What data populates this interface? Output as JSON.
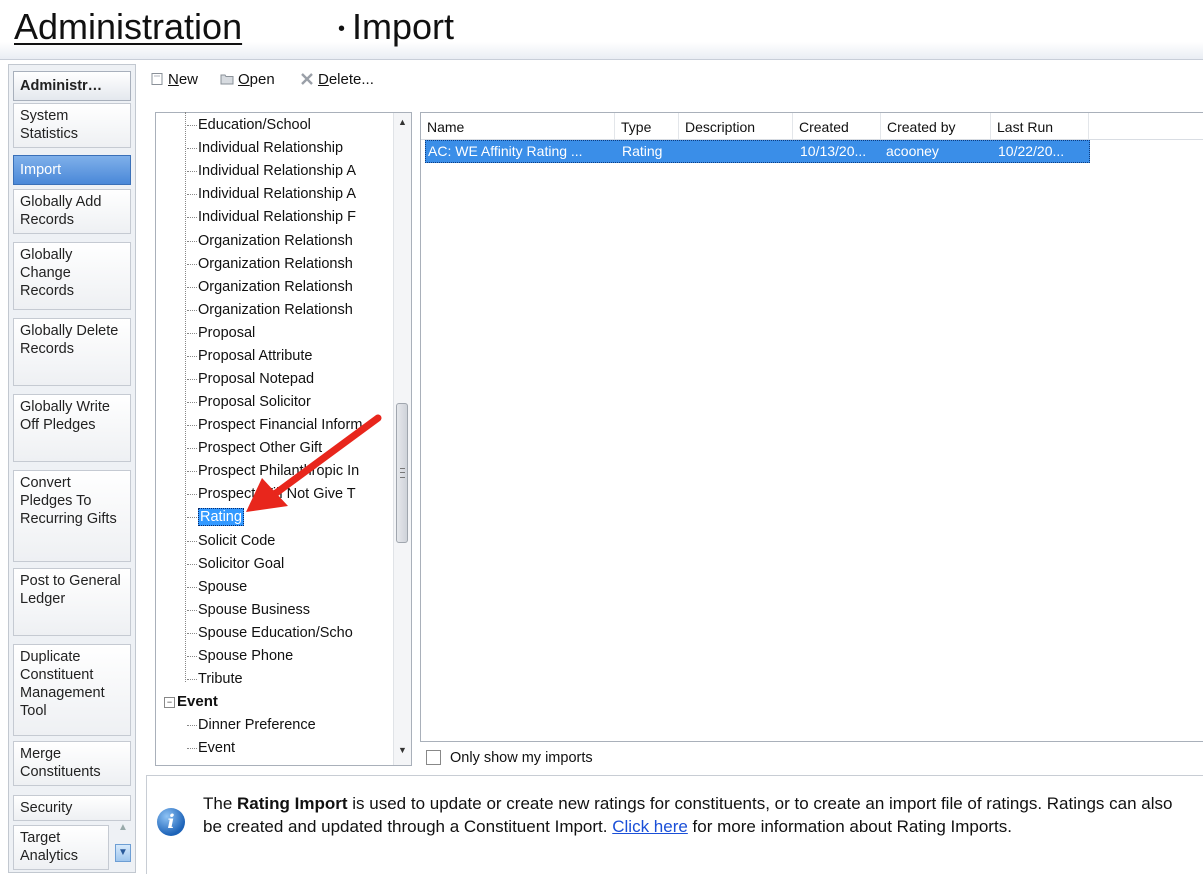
{
  "window": {
    "title_main": "Administration",
    "title_separator": "•",
    "title_sub": "Import"
  },
  "nav": {
    "items": [
      {
        "label": "Administr…",
        "state": "header"
      },
      {
        "label": "System Statistics"
      },
      {
        "label": "Import",
        "state": "active"
      },
      {
        "label": "Globally Add Records"
      },
      {
        "label": "Globally Change Records"
      },
      {
        "label": "Globally Delete Records"
      },
      {
        "label": "Globally Write Off Pledges"
      },
      {
        "label": "Convert Pledges To Recurring Gifts"
      },
      {
        "label": "Post to General Ledger"
      },
      {
        "label": "Duplicate Constituent Management Tool"
      },
      {
        "label": "Merge Constituents"
      },
      {
        "label": "Security"
      },
      {
        "label": "Target Analytics"
      }
    ]
  },
  "toolbar": {
    "new_label": "ew",
    "new_key": "N",
    "open_label": "pen",
    "open_key": "O",
    "delete_label": "elete...",
    "delete_key": "D"
  },
  "tree": {
    "items": [
      "Education/School",
      "Individual Relationship",
      "Individual Relationship A",
      "Individual Relationship A",
      "Individual Relationship F",
      "Organization Relationsh",
      "Organization Relationsh",
      "Organization Relationsh",
      "Organization Relationsh",
      "Proposal",
      "Proposal Attribute",
      "Proposal Notepad",
      "Proposal Solicitor",
      "Prospect Financial Inform",
      "Prospect Other Gift",
      "Prospect Philanthropic In",
      "Prospect Will Not Give T",
      "Rating",
      "Solicit Code",
      "Solicitor Goal",
      "Spouse",
      "Spouse Business",
      "Spouse Education/Scho",
      "Spouse Phone",
      "Tribute"
    ],
    "selected": "Rating",
    "group_label": "Event",
    "group_items": [
      "Dinner Preference",
      "Event"
    ]
  },
  "grid": {
    "columns": [
      "Name",
      "Type",
      "Description",
      "Created",
      "Created by",
      "Last Run"
    ],
    "rows": [
      {
        "name": "AC:  WE Affinity Rating ...",
        "type": "Rating",
        "description": "",
        "created": "10/13/20...",
        "created_by": "acooney",
        "last_run": "10/22/20..."
      }
    ]
  },
  "filter": {
    "only_mine_label": "Only show my imports",
    "only_mine_checked": false
  },
  "info": {
    "prefix": "The ",
    "bold": "Rating Import",
    "text": " is used to update or create new ratings for constituents, or to create an import file of ratings. Ratings can also be created and updated through a Constituent Import. ",
    "link": "Click here",
    "suffix": " for more information about Rating Imports."
  },
  "colors": {
    "selection": "#3399ff",
    "annotation_arrow": "#e8261c",
    "link": "#1a4fd8"
  }
}
